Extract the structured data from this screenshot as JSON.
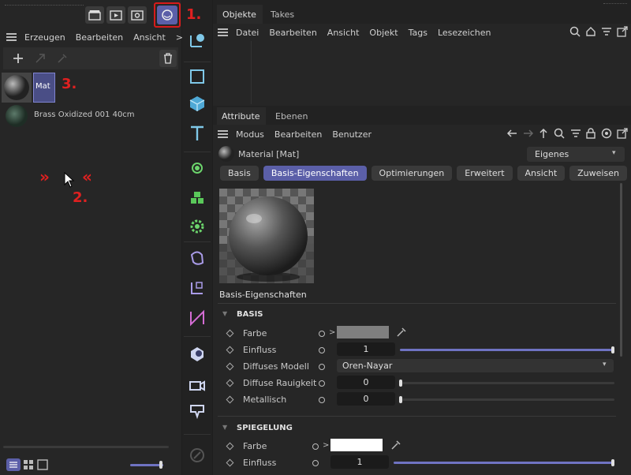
{
  "top_icons": [
    "clapper-icon",
    "render-play-icon",
    "render-settings-icon",
    "material-icon"
  ],
  "left": {
    "menu": [
      "Erzeugen",
      "Bearbeiten",
      "Ansicht",
      ">"
    ],
    "materials": [
      {
        "name": "Mat",
        "selected": true
      },
      {
        "name": "Brass Oxidized 001 40cm",
        "selected": false
      }
    ]
  },
  "annotations": {
    "one": "1.",
    "two": "2.",
    "three": "3.",
    "chev_left": "»",
    "chev_right": "«"
  },
  "right": {
    "tabs_top": [
      "Objekte",
      "Takes"
    ],
    "obj_menu": [
      "Datei",
      "Bearbeiten",
      "Ansicht",
      "Objekt",
      "Tags",
      "Lesezeichen"
    ],
    "tabs_attr": [
      "Attribute",
      "Ebenen"
    ],
    "attr_menu": [
      "Modus",
      "Bearbeiten",
      "Benutzer"
    ],
    "material_title": "Material [Mat]",
    "mode_select": "Eigenes",
    "channel_tabs": [
      "Basis",
      "Basis-Eigenschaften",
      "Optimierungen",
      "Erweitert",
      "Ansicht",
      "Zuweisen"
    ],
    "active_channel": "Basis-Eigenschaften",
    "preview_label": "Basis-Eigenschaften",
    "sections": {
      "basis": {
        "title": "BASIS",
        "farbe": "Farbe",
        "einfluss": "Einfluss",
        "einfluss_val": "1",
        "einfluss_frac": 1.0,
        "diffmod": "Diffuses Modell",
        "diffmod_val": "Oren-Nayar",
        "rauig": "Diffuse Rauigkeit",
        "rauig_val": "0",
        "metall": "Metallisch",
        "metall_val": "0",
        "color": "#7f7f7f"
      },
      "spieg": {
        "title": "SPIEGELUNG",
        "farbe": "Farbe",
        "einfluss": "Einfluss",
        "einfluss_val": "1",
        "color": "#ffffff"
      }
    }
  },
  "colors": {
    "accent": "#5b5fa8",
    "annotation": "#e02020",
    "highlight_border": "#d81b1b"
  }
}
